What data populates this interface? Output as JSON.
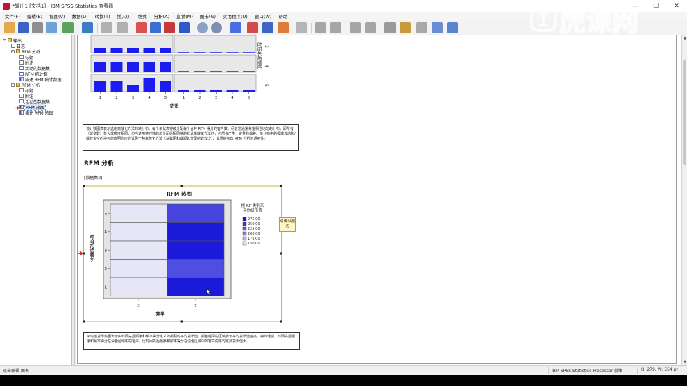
{
  "window": {
    "title": "*输出1 [文档1] - IBM SPSS Statistics 查看器",
    "minimize": "—",
    "maximize": "☐",
    "close": "✕"
  },
  "menus": [
    "文件(F)",
    "编辑(E)",
    "视图(V)",
    "数据(D)",
    "转换(T)",
    "插入(I)",
    "格式",
    "分析(A)",
    "直销(M)",
    "图形(G)",
    "实用程序(U)",
    "窗口(W)",
    "帮助"
  ],
  "tree": {
    "items": [
      {
        "label": "输出",
        "icon": "book",
        "level": 0,
        "expander": "-"
      },
      {
        "label": "日志",
        "icon": "log",
        "level": 1,
        "expander": ""
      },
      {
        "label": "RFM 分析",
        "icon": "book",
        "level": 1,
        "expander": "-"
      },
      {
        "label": "标题",
        "icon": "doc",
        "level": 2,
        "expander": ""
      },
      {
        "label": "附注",
        "icon": "doc",
        "level": 2,
        "expander": ""
      },
      {
        "label": "活动的数据集",
        "icon": "doc",
        "level": 2,
        "expander": ""
      },
      {
        "label": "RFM 统计数",
        "icon": "tbl",
        "level": 2,
        "expander": ""
      },
      {
        "label": "描述 RFM 统计数据",
        "icon": "chart",
        "level": 2,
        "expander": ""
      },
      {
        "label": "RFM 分析",
        "icon": "book",
        "level": 1,
        "expander": "-"
      },
      {
        "label": "标题",
        "icon": "doc",
        "level": 2,
        "expander": ""
      },
      {
        "label": "附注",
        "icon": "doc",
        "level": 2,
        "expander": ""
      },
      {
        "label": "活动的数据集",
        "icon": "doc",
        "level": 2,
        "expander": ""
      },
      {
        "label": "RFM 热图",
        "icon": "chart",
        "level": 2,
        "expander": "",
        "selected": true
      },
      {
        "label": "描述 RFM 热图",
        "icon": "chart",
        "level": 2,
        "expander": ""
      }
    ]
  },
  "bar_matrix": {
    "row_labels": [
      "3",
      "4",
      "5"
    ],
    "row_axis_label": "时间先后顺序",
    "x_ticks": [
      "1",
      "2",
      "3",
      "4",
      "5"
    ],
    "x_label": "货币",
    "rows": [
      {
        "left": [
          0.28,
          0.28,
          0.28,
          0.28,
          0.28
        ],
        "right": [
          0.03,
          0.03,
          0.03,
          0.03,
          0.03
        ]
      },
      {
        "left": [
          0.6,
          0.6,
          0.6,
          0.6,
          0.6
        ],
        "right": [
          0.07,
          0.07,
          0.07,
          0.07,
          0.07
        ]
      },
      {
        "left": [
          0.62,
          0.62,
          0.38,
          0.78,
          0.62
        ],
        "right": [
          0.09,
          0.09,
          0.09,
          0.09,
          0.09
        ]
      }
    ]
  },
  "note1": "该计数图表表示选定离散化方法的块分布。每个条代表将被分配每个合并 RFM 得分的客户数。尽管您通常希望相当均匀的分布，即所有（或多数）条大体高度相同，但当使用将时数的值分配给相同块的默认离散化方法时，必然会产生一定量的偏差。块分布中的极端波动和/或较多空的块可能表明您应尝试另一种离散化方法（块数更和或顺其分配给数较少），或重新考虑 RFM 分析的适用性。",
  "section_heading": "RFM 分析",
  "dataset_label": "[数据集2]",
  "heatmap": {
    "chart_data": {
      "type": "heatmap",
      "title": "RFM 热图",
      "xlabel": "频率",
      "ylabel": "时间先后顺序",
      "x_categories": [
        "3",
        "5"
      ],
      "y_categories": [
        "1",
        "2",
        "3",
        "4",
        "5"
      ],
      "legend_title": "按 RF 类别来平均货币值",
      "legend_labels": [
        "275.00",
        "250.00",
        "225.00",
        "200.00",
        "175.00",
        "150.00"
      ],
      "legend_colors": [
        "#1a1ad8",
        "#3636e0",
        "#5959e6",
        "#8585ec",
        "#b3b3f2",
        "#e6e6f7"
      ],
      "values": [
        {
          "x": "3",
          "y": "5",
          "value": 150
        },
        {
          "x": "3",
          "y": "4",
          "value": 150
        },
        {
          "x": "3",
          "y": "3",
          "value": 150
        },
        {
          "x": "3",
          "y": "2",
          "value": 150
        },
        {
          "x": "3",
          "y": "1",
          "value": 150
        },
        {
          "x": "5",
          "y": "5",
          "value": 248
        },
        {
          "x": "5",
          "y": "4",
          "value": 275
        },
        {
          "x": "5",
          "y": "3",
          "value": 275
        },
        {
          "x": "5",
          "y": "2",
          "value": 243
        },
        {
          "x": "5",
          "y": "1",
          "value": 275
        }
      ]
    }
  },
  "tooltip": "双击以激活",
  "note2": "平均值货币热图表示由时间先后顺序和频率得分定义的类别的平均货币值。颜色越深的区域表示平均货币值越高。换句话说，时间先后顺序和频率得分在深色区域中的客户，比时间先后顺序和频率得分在浅色区域中的客户的平均花费货币值大。",
  "status": {
    "left": "双击编辑 图表",
    "processor": "IBM SPSS Statistics Processor 就绪",
    "coords": "H: 279, W: 554 pt"
  },
  "watermark": "虎课网"
}
